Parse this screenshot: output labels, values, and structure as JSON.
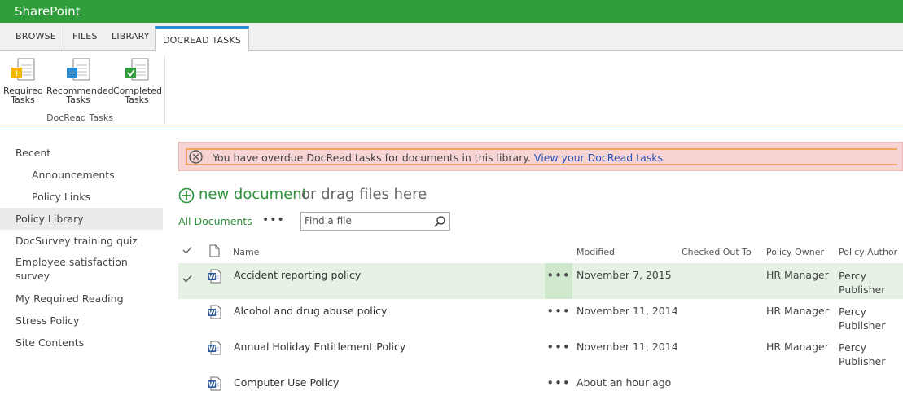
{
  "suite": {
    "brand": "SharePoint"
  },
  "tabs": [
    "BROWSE",
    "FILES",
    "LIBRARY",
    "DOCREAD TASKS"
  ],
  "ribbon": {
    "buttons": [
      {
        "line1": "Required",
        "line2": "Tasks",
        "badge_color": "#f4b400"
      },
      {
        "line1": "Recommended",
        "line2": "Tasks",
        "badge_color": "#2a8dd4"
      },
      {
        "line1": "Completed",
        "line2": "Tasks",
        "badge_color": "#2f9e3a"
      }
    ],
    "group_label": "DocRead Tasks"
  },
  "leftnav": {
    "items": [
      {
        "label": "Recent"
      },
      {
        "label": "Announcements"
      },
      {
        "label": "Policy Links"
      },
      {
        "label": "Policy Library"
      },
      {
        "label": "DocSurvey training quiz"
      },
      {
        "label": "Employee satisfaction survey"
      },
      {
        "label": "My Required Reading"
      },
      {
        "label": "Stress Policy"
      },
      {
        "label": "Site Contents"
      }
    ]
  },
  "banner": {
    "message": "You have overdue DocRead tasks for documents in this library.",
    "link": "View your DocRead tasks"
  },
  "newdoc": {
    "link": "new document",
    "rest": "or drag files here"
  },
  "view": {
    "label": "All Documents",
    "more": "•••"
  },
  "search": {
    "placeholder": "Find a file"
  },
  "columns": {
    "name": "Name",
    "modified": "Modified",
    "checked_out_to": "Checked Out To",
    "policy_owner": "Policy Owner",
    "policy_author": "Policy Author"
  },
  "documents": [
    {
      "name": "Accident reporting policy",
      "modified": "November 7, 2015",
      "checked_out_to": "",
      "owner": "HR Manager",
      "author": "Percy Publisher",
      "selected": true
    },
    {
      "name": "Alcohol and drug abuse policy",
      "modified": "November 11, 2014",
      "checked_out_to": "",
      "owner": "HR Manager",
      "author": "Percy Publisher",
      "selected": false
    },
    {
      "name": "Annual Holiday Entitlement Policy",
      "modified": "November 11, 2014",
      "checked_out_to": "",
      "owner": "HR Manager",
      "author": "Percy Publisher",
      "selected": false
    },
    {
      "name": "Computer Use Policy",
      "modified": "About an hour ago",
      "checked_out_to": "",
      "owner": "",
      "author": "",
      "selected": false
    }
  ],
  "colors": {
    "suitebar": "#2f9e3a",
    "accent_blue": "#2a8dd4",
    "link_green": "#2f8f3a",
    "banner_bg": "#f8d3d3",
    "selected_row": "#e5f2e4"
  }
}
